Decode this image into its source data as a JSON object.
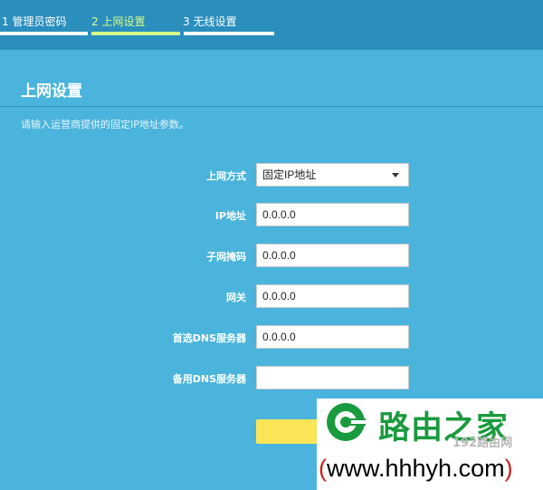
{
  "steps": [
    {
      "label": "1 管理员密码"
    },
    {
      "label": "2 上网设置"
    },
    {
      "label": "3 无线设置"
    }
  ],
  "active_step": 2,
  "colors": {
    "background": "#4ab4dc",
    "header": "#2b8fbd",
    "active_step": "#d4ff8a",
    "save_button": "#fbe556",
    "watermark_green": "#1a9a3e",
    "watermark_red": "#cc1f1f"
  },
  "page": {
    "title": "上网设置",
    "instruction": "请输入运营商提供的固定IP地址参数。"
  },
  "form": {
    "connection_type": {
      "label": "上网方式",
      "value": "固定IP地址"
    },
    "ip_address": {
      "label": "IP地址",
      "value": "0.0.0.0"
    },
    "subnet_mask": {
      "label": "子网掩码",
      "value": "0.0.0.0"
    },
    "gateway": {
      "label": "网关",
      "value": "0.0.0.0"
    },
    "primary_dns": {
      "label": "首选DNS服务器",
      "value": "0.0.0.0"
    },
    "secondary_dns": {
      "label": "备用DNS服务器",
      "value": ""
    }
  },
  "watermark": {
    "name": "路由之家",
    "faint_text": "192路由网",
    "url_open": "(",
    "url": "www.hhhyh.com",
    "url_close": ")"
  }
}
